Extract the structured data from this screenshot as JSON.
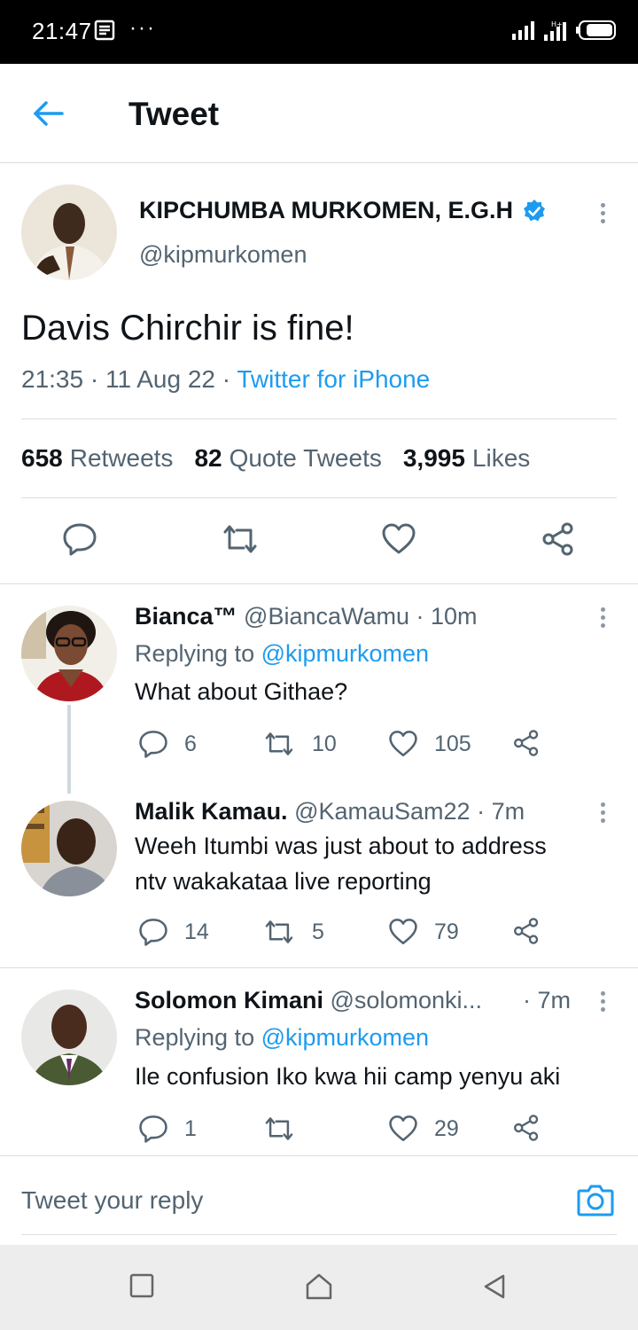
{
  "status_bar": {
    "time": "21:47",
    "more": "···"
  },
  "header": {
    "title": "Tweet"
  },
  "tweet": {
    "author_name": "KIPCHUMBA MURKOMEN, E.G.H",
    "handle": "@kipmurkomen",
    "text": "Davis Chirchir is fine!",
    "time_date": "21:35 · 11 Aug 22 · ",
    "source": "Twitter for iPhone",
    "retweets_count": "658",
    "retweets_label": "Retweets",
    "quotes_count": "82",
    "quotes_label": "Quote Tweets",
    "likes_count": "3,995",
    "likes_label": "Likes"
  },
  "replies": [
    {
      "name": "Bianca™",
      "handle_time": " @BiancaWamu · 10m",
      "replying_prefix": "Replying to ",
      "replying_handle": "@kipmurkomen",
      "text_lines": [
        "What about Githae?"
      ],
      "replies": "6",
      "retweets": "10",
      "likes": "105"
    },
    {
      "name": "Malik Kamau.",
      "handle_time": " @KamauSam22 · 7m",
      "text_lines": [
        "Weeh Itumbi was just about to address",
        "ntv wakakataa live reporting"
      ],
      "replies": "14",
      "retweets": "5",
      "likes": "79"
    },
    {
      "name": "Solomon Kimani",
      "handle_time": " @solomonki...",
      "time": "· 7m",
      "replying_prefix": "Replying to ",
      "replying_handle": "@kipmurkomen",
      "text_lines": [
        "Ile confusion Iko kwa hii camp yenyu aki"
      ],
      "replies": "1",
      "retweets": "",
      "likes": "29"
    }
  ],
  "reply_box": {
    "placeholder": "Tweet your reply"
  },
  "colors": {
    "accent": "#1d9bf0",
    "text": "#0f1419",
    "secondary": "#536471",
    "divider": "#d9dee2"
  }
}
